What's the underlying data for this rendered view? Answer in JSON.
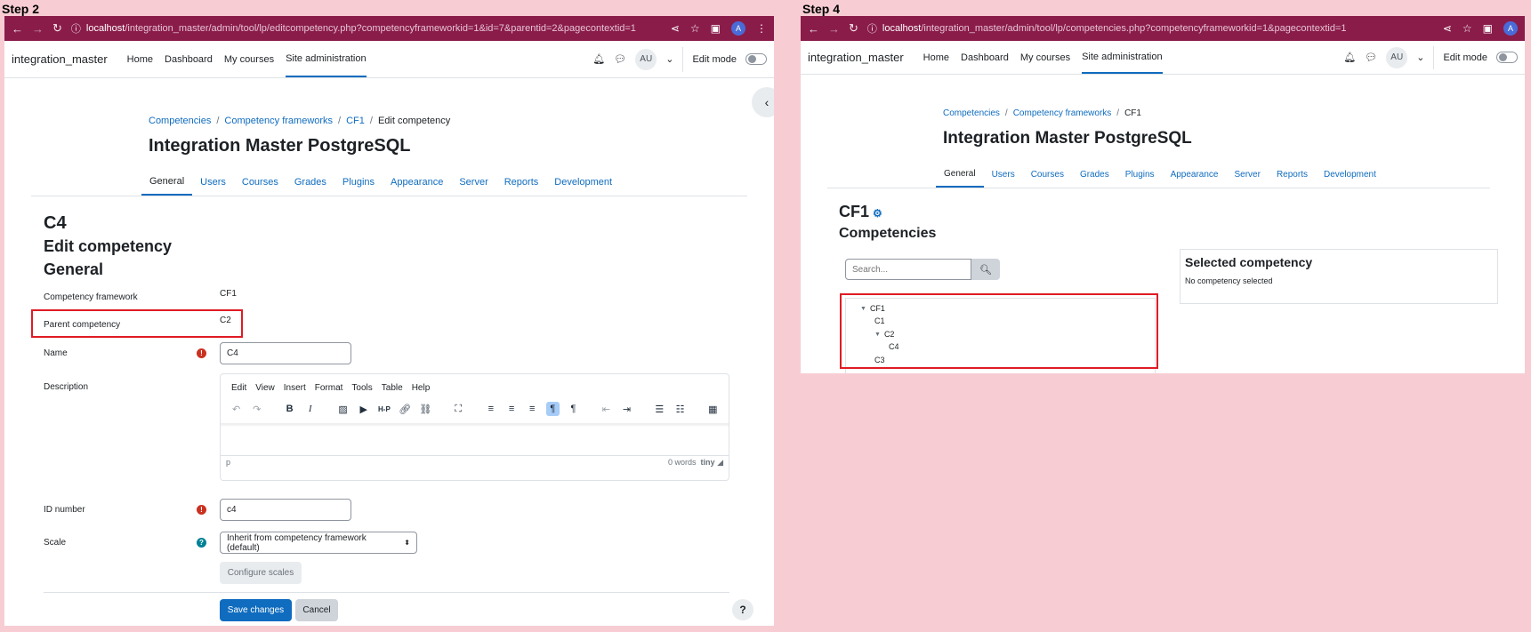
{
  "labels": {
    "step2": "Step 2",
    "step4": "Step 4"
  },
  "colors": {
    "browser": "#8a1c4a",
    "link": "#0f6cbf",
    "highlight": "#e01b24",
    "required": "#ca3120",
    "help": "#008196"
  },
  "step2": {
    "url_host": "localhost",
    "url_path": "/integration_master/admin/tool/lp/editcompetency.php?competencyframeworkid=1&id=7&parentid=2&pagecontextid=1",
    "brand": "integration_master",
    "nav": {
      "home": "Home",
      "dashboard": "Dashboard",
      "my_courses": "My courses",
      "site_admin": "Site administration"
    },
    "user_initials": "AU",
    "edit_mode": "Edit mode",
    "breadcrumb": [
      "Competencies",
      "Competency frameworks",
      "CF1",
      "Edit competency"
    ],
    "heading": "Integration Master PostgreSQL",
    "tabs": [
      "General",
      "Users",
      "Courses",
      "Grades",
      "Plugins",
      "Appearance",
      "Server",
      "Reports",
      "Development"
    ],
    "title_c4": "C4",
    "title_edit": "Edit competency",
    "title_general": "General",
    "form": {
      "framework_label": "Competency framework",
      "framework_value": "CF1",
      "parent_label": "Parent competency",
      "parent_value": "C2",
      "name_label": "Name",
      "name_value": "C4",
      "description_label": "Description",
      "idnumber_label": "ID number",
      "idnumber_value": "c4",
      "scale_label": "Scale",
      "scale_value": "Inherit from competency framework (default)",
      "configure_scales": "Configure scales",
      "save": "Save changes",
      "cancel": "Cancel"
    },
    "editor": {
      "menu": [
        "Edit",
        "View",
        "Insert",
        "Format",
        "Tools",
        "Table",
        "Help"
      ],
      "status_path": "p",
      "word_count": "0 words",
      "brand": "tiny"
    },
    "help_button": "?"
  },
  "step4": {
    "url_host": "localhost",
    "url_path": "/integration_master/admin/tool/lp/competencies.php?competencyframeworkid=1&pagecontextid=1",
    "brand": "integration_master",
    "nav": {
      "home": "Home",
      "dashboard": "Dashboard",
      "my_courses": "My courses",
      "site_admin": "Site administration"
    },
    "user_initials": "AU",
    "edit_mode": "Edit mode",
    "breadcrumb": [
      "Competencies",
      "Competency frameworks",
      "CF1"
    ],
    "heading": "Integration Master PostgreSQL",
    "tabs": [
      "General",
      "Users",
      "Courses",
      "Grades",
      "Plugins",
      "Appearance",
      "Server",
      "Reports",
      "Development"
    ],
    "framework_title": "CF1",
    "competencies_heading": "Competencies",
    "search_placeholder": "Search...",
    "tree": [
      {
        "label": "CF1",
        "level": 0,
        "expanded": true
      },
      {
        "label": "C1",
        "level": 1,
        "expanded": false
      },
      {
        "label": "C2",
        "level": 1,
        "expanded": true
      },
      {
        "label": "C4",
        "level": 2,
        "expanded": false
      },
      {
        "label": "C3",
        "level": 1,
        "expanded": false
      }
    ],
    "selected_heading": "Selected competency",
    "selected_empty": "No competency selected"
  }
}
